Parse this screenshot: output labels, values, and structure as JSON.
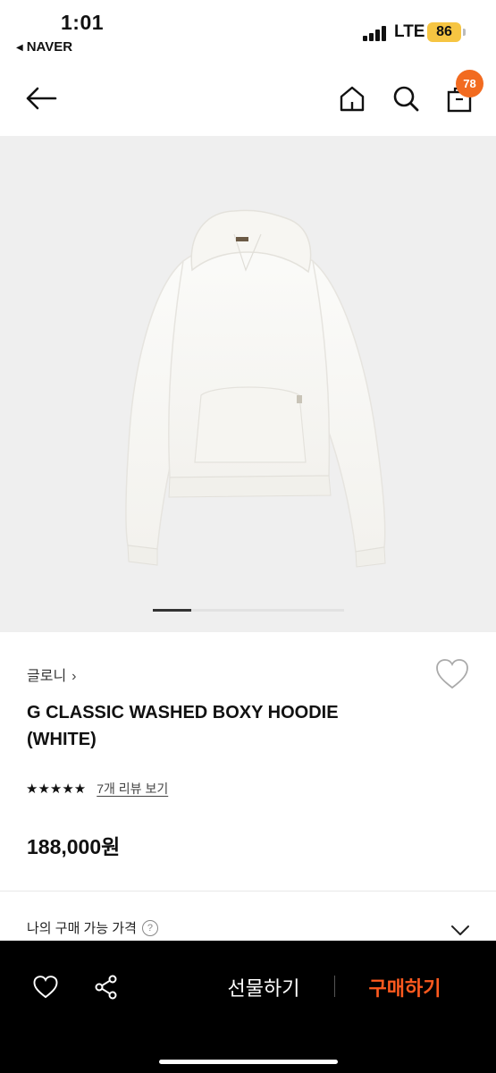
{
  "status_bar": {
    "time": "1:01",
    "back_app": "NAVER",
    "network": "LTE",
    "battery": "86",
    "battery_color": "#f6c542"
  },
  "header": {
    "back_icon": "arrow-left-icon",
    "home_icon": "home-icon",
    "search_icon": "search-icon",
    "cart_icon": "shopping-bag-icon",
    "cart_count": "78",
    "badge_color": "#f26b20"
  },
  "product": {
    "image_alt": "white hoodie",
    "slide_position": "1",
    "brand": "글로니",
    "name": "G CLASSIC WASHED BOXY HOODIE (WHITE)",
    "rating": 4.5,
    "stars": "★★★★★",
    "review_link": "7개 리뷰 보기",
    "price": "188,000원"
  },
  "options": {
    "my_price_label": "나의 구매 가능 가격",
    "help_glyph": "?"
  },
  "bottom_bar": {
    "wish_icon": "heart-icon",
    "share_icon": "share-icon",
    "gift_label": "선물하기",
    "buy_label": "구매하기",
    "buy_color": "#ff5a1f"
  }
}
